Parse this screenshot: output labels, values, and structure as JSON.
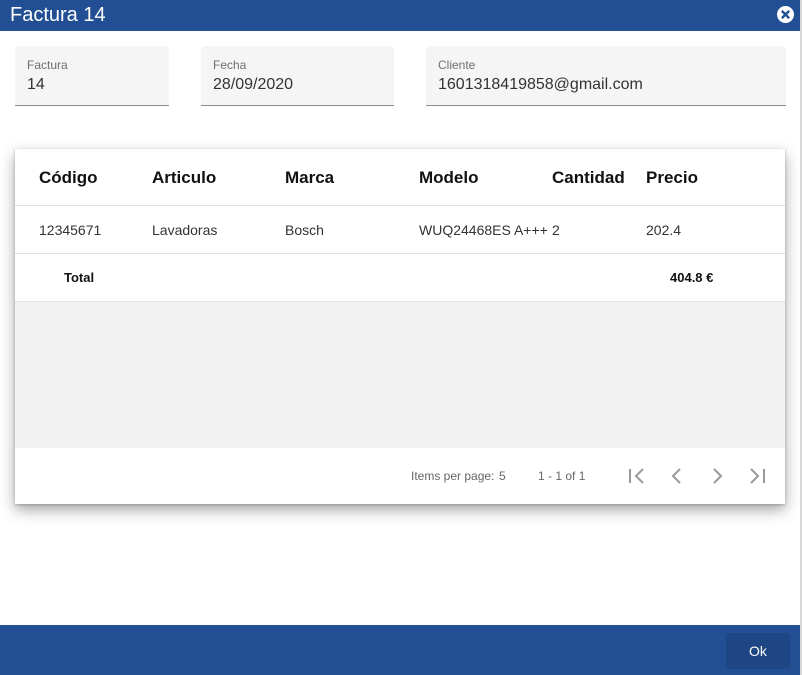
{
  "dialog": {
    "title": "Factura 14"
  },
  "fields": {
    "factura": {
      "label": "Factura",
      "value": "14"
    },
    "fecha": {
      "label": "Fecha",
      "value": "28/09/2020"
    },
    "cliente": {
      "label": "Cliente",
      "value": "1601318419858@gmail.com"
    }
  },
  "table": {
    "headers": [
      "Código",
      "Articulo",
      "Marca",
      "Modelo",
      "Cantidad",
      "Precio"
    ],
    "rows": [
      {
        "codigo": "12345671",
        "articulo": "Lavadoras",
        "marca": "Bosch",
        "modelo": "WUQ24468ES A+++",
        "cantidad": "2",
        "precio": "202.4"
      }
    ],
    "footer": {
      "label": "Total",
      "total": "404.8 €"
    }
  },
  "paginator": {
    "items_per_page_label": "Items per page:",
    "items_per_page": "5",
    "range_label": "1 - 1 of 1",
    "icons": [
      "first-page-icon",
      "previous-page-icon",
      "next-page-icon",
      "last-page-icon"
    ]
  },
  "footer": {
    "ok_label": "Ok"
  },
  "colors": {
    "primary": "#224f93",
    "button": "#1e4684",
    "field_bg": "#f5f5f5"
  }
}
